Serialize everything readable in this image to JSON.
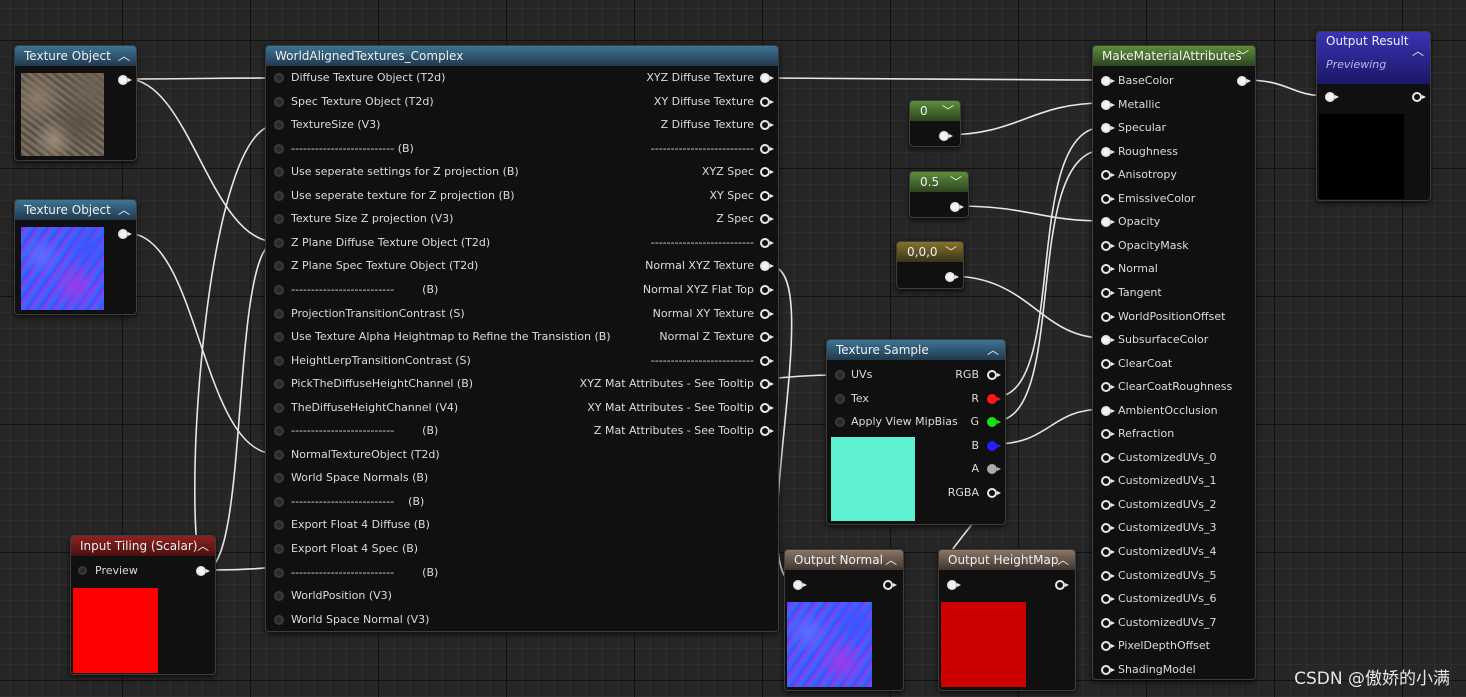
{
  "nodes": {
    "tex_obj_1": {
      "title": "Texture Object"
    },
    "tex_obj_2": {
      "title": "Texture Object"
    },
    "input_tiling": {
      "title": "Input Tiling (Scalar)",
      "pin_preview": "Preview",
      "preview_color": "#ff0000"
    },
    "world_aligned": {
      "title": "WorldAlignedTextures_Complex",
      "inputs": [
        "Diffuse Texture Object (T2d)",
        "Spec Texture Object (T2d)",
        "TextureSize (V3)",
        "-------------------------- (B)",
        "Use seperate settings for Z projection (B)",
        "Use seperate texture for Z projection (B)",
        "Texture Size Z projection (V3)",
        "Z Plane Diffuse Texture Object (T2d)",
        "Z Plane Spec Texture Object (T2d)",
        "--------------------------        (B)",
        "ProjectionTransitionContrast (S)",
        "Use Texture Alpha Heightmap to Refine the Transistion (B)",
        "HeightLerpTransitionContrast (S)",
        "PickTheDiffuseHeightChannel (B)",
        "TheDiffuseHeightChannel (V4)",
        "--------------------------        (B)",
        "NormalTextureObject (T2d)",
        "World Space Normals (B)",
        "--------------------------    (B)",
        "Export Float 4 Diffuse (B)",
        "Export Float 4 Spec (B)",
        "--------------------------        (B)",
        "WorldPosition (V3)",
        "World Space Normal (V3)"
      ],
      "outputs": [
        "XYZ Diffuse Texture",
        "XY Diffuse Texture",
        "Z Diffuse Texture",
        "--------------------------",
        "XYZ Spec",
        "XY Spec",
        "Z Spec",
        "--------------------------",
        "Normal XYZ Texture",
        "Normal XYZ Flat Top",
        "Normal XY Texture",
        "Normal Z Texture",
        "--------------------------",
        "XYZ Mat Attributes - See Tooltip",
        "XY Mat Attributes - See Tooltip",
        "Z Mat Attributes - See Tooltip"
      ]
    },
    "const_0": {
      "value": "0"
    },
    "const_05": {
      "value": "0.5"
    },
    "const_vec": {
      "value": "0,0,0"
    },
    "texture_sample": {
      "title": "Texture Sample",
      "inputs": [
        "UVs",
        "Tex",
        "Apply View MipBias"
      ],
      "outputs": [
        "RGB",
        "R",
        "G",
        "B",
        "A",
        "RGBA"
      ],
      "preview_color": "#5ff0d2"
    },
    "output_normal": {
      "title": "Output Normal"
    },
    "output_heightmap": {
      "title": "Output HeightMap",
      "preview_color": "#cc0000"
    },
    "make_material": {
      "title": "MakeMaterialAttributes",
      "inputs": [
        "BaseColor",
        "Metallic",
        "Specular",
        "Roughness",
        "Anisotropy",
        "EmissiveColor",
        "Opacity",
        "OpacityMask",
        "Normal",
        "Tangent",
        "WorldPositionOffset",
        "SubsurfaceColor",
        "ClearCoat",
        "ClearCoatRoughness",
        "AmbientOcclusion",
        "Refraction",
        "CustomizedUVs_0",
        "CustomizedUVs_1",
        "CustomizedUVs_2",
        "CustomizedUVs_3",
        "CustomizedUVs_4",
        "CustomizedUVs_5",
        "CustomizedUVs_6",
        "CustomizedUVs_7",
        "PixelDepthOffset",
        "ShadingModel"
      ]
    },
    "output_result": {
      "title": "Output Result",
      "subtitle": "Previewing"
    }
  },
  "watermark": "CSDN @傲娇的小满",
  "colors": {
    "canvas": "#262626",
    "header_blue": "#3d7494",
    "header_green": "#5d8f3a",
    "header_brown": "#86722e",
    "header_red": "#8e2222",
    "header_tan": "#8a7666",
    "header_purple": "#3a33b5",
    "pin_r": "#ff1818",
    "pin_g": "#18e018",
    "pin_b": "#2020ff"
  },
  "icons": {
    "collapse": "chevron-up-icon",
    "dropdown": "chevron-down-icon"
  }
}
